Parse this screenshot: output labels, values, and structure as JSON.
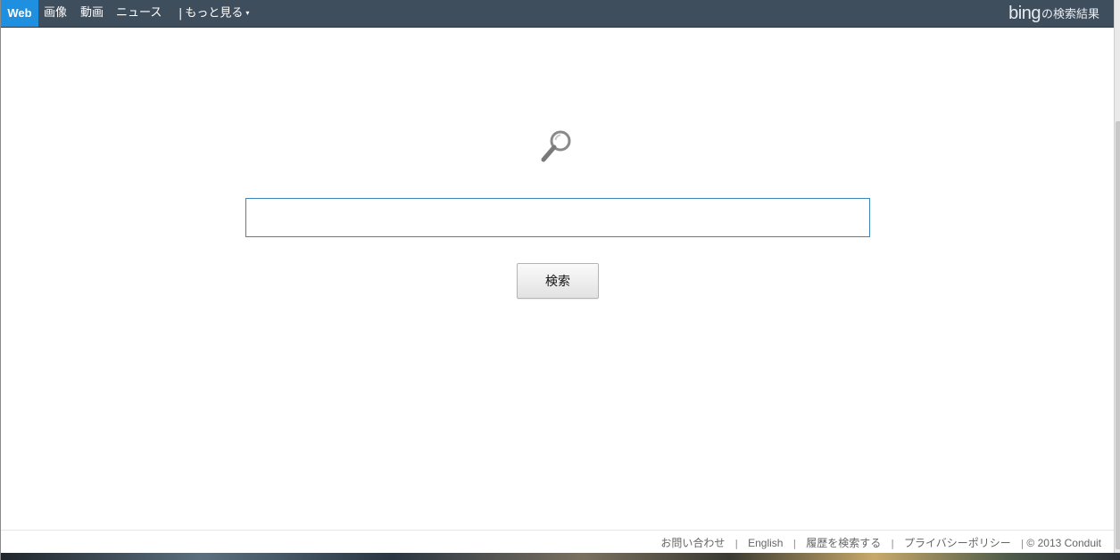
{
  "nav": {
    "web": "Web",
    "images": "画像",
    "video": "動画",
    "news": "ニュース",
    "more_separator": "|",
    "more": "もっと見る",
    "more_caret": "▾"
  },
  "brand": {
    "logo": "bing",
    "suffix": "の検索結果"
  },
  "search": {
    "value": "",
    "placeholder": "",
    "button_label": "検索"
  },
  "footer": {
    "contact": "お問い合わせ",
    "english": "English",
    "history": "履歴を検索する",
    "privacy": "プライバシーポリシー",
    "copyright": "© 2013 Conduit",
    "separator": "|"
  },
  "colors": {
    "topbar": "#3f4e5d",
    "web_tab": "#1f8fdf",
    "search_border": "#3d86bd"
  },
  "icons": {
    "center": "magnifier-icon",
    "more": "caret-down-icon"
  }
}
